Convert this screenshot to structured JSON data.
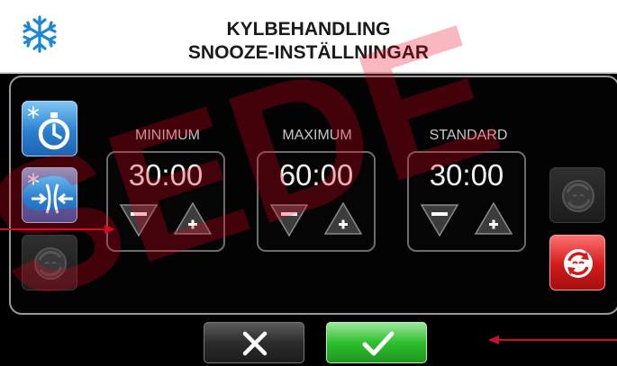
{
  "header": {
    "title_line1": "KYLBEHANDLING",
    "title_line2": "SNOOZE-INSTÄLLNINGAR",
    "icon": "snowflake-icon"
  },
  "side_left": [
    {
      "icon": "snowflake-timer-icon",
      "state": "active"
    },
    {
      "icon": "snowflake-compress-icon",
      "state": "active"
    },
    {
      "icon": "snooze-cycle-icon",
      "state": "disabled"
    }
  ],
  "side_right": [
    {
      "icon": "snooze-cycle-icon",
      "state": "disabled"
    },
    {
      "icon": "snooze-reset-icon",
      "state": "active"
    }
  ],
  "settings": [
    {
      "label": "MINIMUM",
      "value": "30:00"
    },
    {
      "label": "MAXIMUM",
      "value": "60:00"
    },
    {
      "label": "STANDARD",
      "value": "30:00"
    }
  ],
  "stepper": {
    "minus_symbol": "−",
    "plus_symbol": "+"
  },
  "actions": {
    "cancel_icon": "close-icon",
    "confirm_icon": "checkmark-icon"
  },
  "colors": {
    "accent_blue": "#2a7fd0",
    "reset_red": "#d21a1a",
    "confirm_green": "#2ec02e",
    "annotation_red": "#c8102e"
  },
  "watermark": {
    "text": "SEDE"
  }
}
